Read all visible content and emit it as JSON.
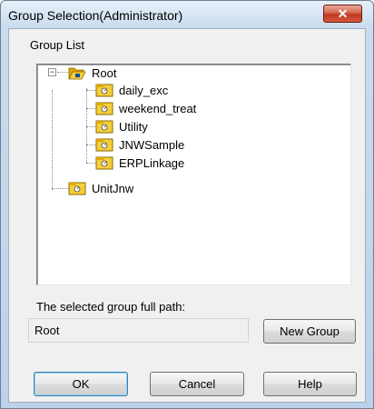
{
  "window": {
    "title": "Group Selection(Administrator)",
    "close_glyph": "✕"
  },
  "group_list": {
    "label": "Group List",
    "tree": [
      {
        "label": "Root",
        "expanded": true,
        "expander": "−"
      },
      {
        "label": "daily_exc"
      },
      {
        "label": "weekend_treat"
      },
      {
        "label": "Utility"
      },
      {
        "label": "JNWSample"
      },
      {
        "label": "ERPLinkage"
      },
      {
        "label": "UnitJnw"
      }
    ]
  },
  "path": {
    "label": "The selected group full path:",
    "value": "Root"
  },
  "buttons": {
    "new_group": "New Group",
    "ok": "OK",
    "cancel": "Cancel",
    "help": "Help"
  },
  "colors": {
    "folder": "#f2c21b",
    "close": "#c0391f",
    "title_bg": "#c9dbee"
  }
}
